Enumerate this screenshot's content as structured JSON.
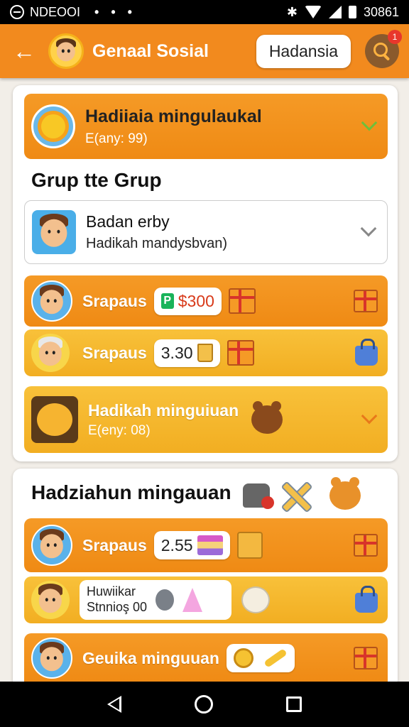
{
  "status_bar": {
    "carrier": "NDEOOI",
    "dots": "• • •",
    "time": "30861"
  },
  "app_bar": {
    "title": "Genaal Sosial",
    "pill": "Hadansia",
    "notification_count": "1"
  },
  "card1": {
    "header": {
      "title": "Hadiiaia mingulaukal",
      "subtitle": "E(any: 99)"
    },
    "section_title": "Grup tte Grup",
    "dropdown": {
      "title": "Badan erby",
      "subtitle": "Hadikah mandysbvan)"
    },
    "rows": [
      {
        "label": "Srapaus",
        "value": "$300"
      },
      {
        "label": "Srapaus",
        "value": "3.30"
      }
    ],
    "footer": {
      "title": "Hadikah minguiuan",
      "subtitle": "E(eny: 08)"
    }
  },
  "card2": {
    "section_title": "Hadziahun mingauan",
    "rows": [
      {
        "label": "Srapaus",
        "value": "2.55"
      },
      {
        "line1": "Huwiikar",
        "line2": "Stnnioş 00"
      },
      {
        "label": "Geuika minguuan"
      }
    ]
  },
  "colors": {
    "accent": "#f28a1e",
    "yellow": "#f2ae22",
    "checkmark": "#6fbf3a",
    "chevron_orange": "#e8781a"
  }
}
